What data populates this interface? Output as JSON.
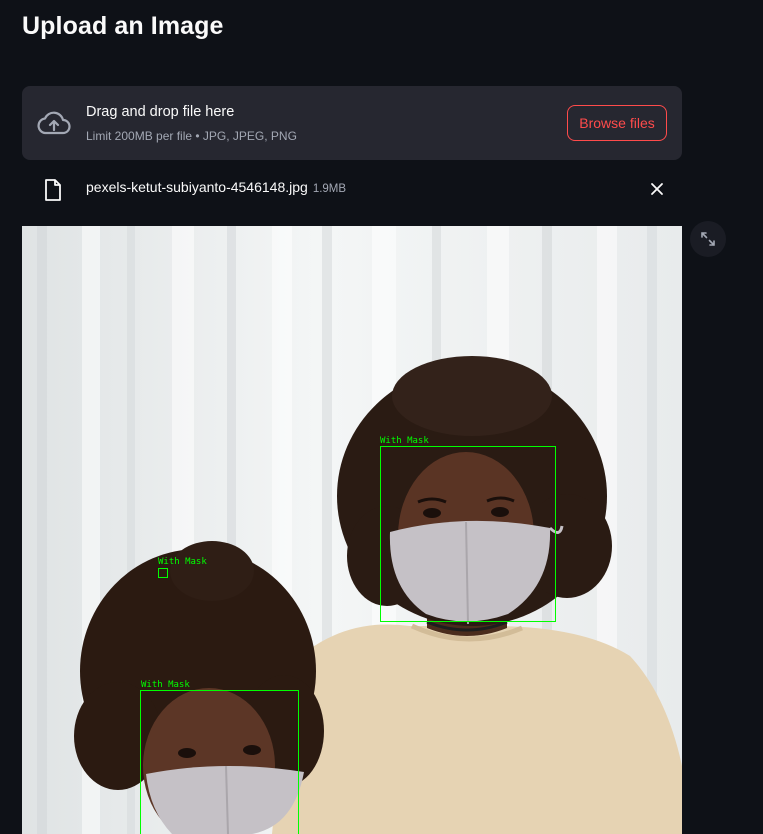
{
  "page": {
    "title": "Upload an Image"
  },
  "uploader": {
    "icon": "cloud-upload-icon",
    "drop_text": "Drag and drop file here",
    "limit_text": "Limit 200MB per file • JPG, JPEG, PNG",
    "browse_label": "Browse files",
    "accent_color": "#ff4b4b"
  },
  "file": {
    "icon": "file-icon",
    "name": "pexels-ketut-subiyanto-4546148.jpg",
    "size": "1.9MB",
    "remove_icon": "close-icon"
  },
  "image": {
    "fullscreen_icon": "expand-icon",
    "detections": [
      {
        "label": "With Mask"
      },
      {
        "label": "With Mask"
      },
      {
        "label": "With Mask"
      }
    ],
    "detection_color": "#00ff00"
  },
  "theme": {
    "background": "#0e1117",
    "surface": "#262730",
    "text": "#fafafa",
    "muted_text": "#a3a8b4"
  }
}
